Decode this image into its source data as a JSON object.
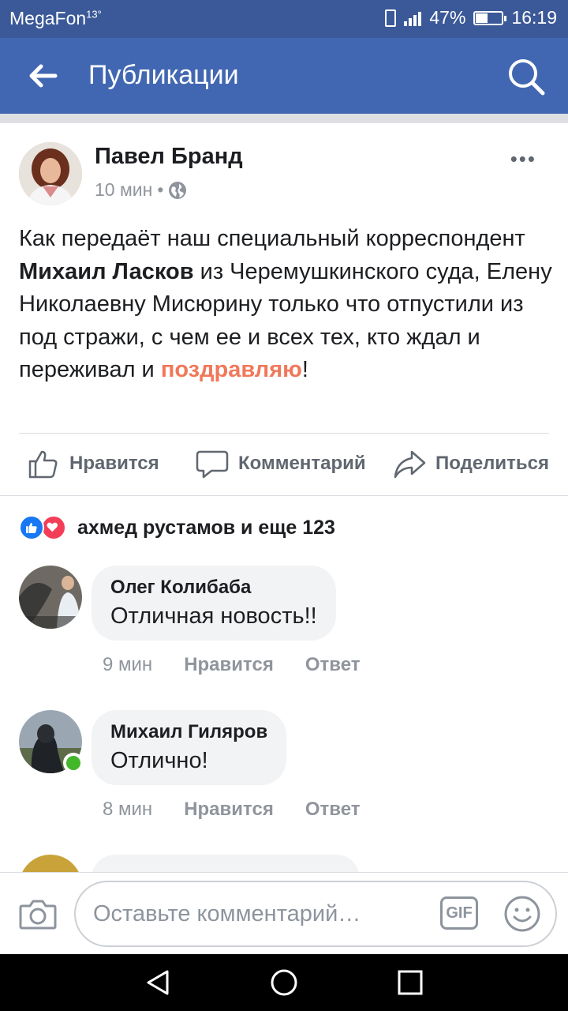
{
  "status_bar": {
    "carrier": "MegaFon",
    "temperature": "13°",
    "battery": "47%",
    "battery_level": 0.47,
    "time": "16:19"
  },
  "app_bar": {
    "title": "Публикации"
  },
  "post": {
    "author": "Павел Бранд",
    "time": "10 мин",
    "separator": "•",
    "text_parts": {
      "p1": "Как передаёт наш специальный корреспондент ",
      "bold_name": "Михаил Ласков",
      "p2": " из Черемушкинского суда, Елену Николаевну Мисюрину только что отпустили из под стражи, с чем ее и всех тех, кто ждал и переживал и ",
      "highlight": "поздравляю",
      "p3": "!"
    },
    "actions": {
      "like": "Нравится",
      "comment": "Комментарий",
      "share": "Поделиться"
    }
  },
  "reactions": {
    "text": "ахмед рустамов и еще 123"
  },
  "comments": [
    {
      "name": "Олег Колибаба",
      "text": "Отличная новость!!",
      "time": "9 мин",
      "like": "Нравится",
      "reply": "Ответ"
    },
    {
      "name": "Михаил Гиляров",
      "text": "Отлично!",
      "time": "8 мин",
      "like": "Нравится",
      "reply": "Ответ"
    }
  ],
  "composer": {
    "placeholder": "Оставьте комментарий…",
    "gif_label": "GIF"
  },
  "colors": {
    "brand": "#4267b2",
    "status_bar": "#3b5998",
    "highlight": "#f0785a",
    "online": "#42b72a"
  }
}
